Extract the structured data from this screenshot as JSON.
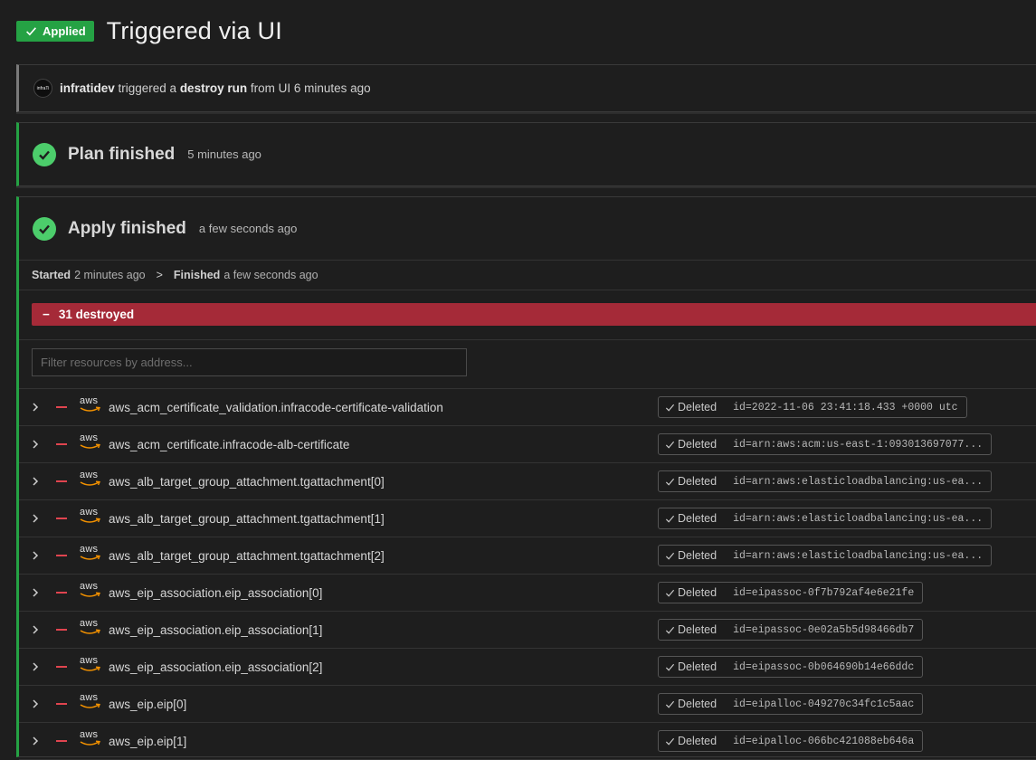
{
  "header": {
    "badge": "Applied",
    "title": "Triggered via UI"
  },
  "trigger": {
    "avatar_text": "infraTi",
    "user": "infratidev",
    "text1": " triggered a ",
    "run_type": "destroy run",
    "text2": " from UI 6 minutes ago"
  },
  "plan": {
    "title": "Plan finished",
    "time": "5 minutes ago"
  },
  "apply": {
    "title": "Apply finished",
    "time": "a few seconds ago",
    "started_label": "Started",
    "started_time": "2 minutes ago",
    "separator": ">",
    "finished_label": "Finished",
    "finished_time": "a few seconds ago",
    "destroyed_summary": "31 destroyed",
    "filter_placeholder": "Filter resources by address..."
  },
  "resources": [
    {
      "address": "aws_acm_certificate_validation.infracode-certificate-validation",
      "status": "Deleted",
      "id": "id=2022-11-06 23:41:18.433 +0000 utc"
    },
    {
      "address": "aws_acm_certificate.infracode-alb-certificate",
      "status": "Deleted",
      "id": "id=arn:aws:acm:us-east-1:093013697077..."
    },
    {
      "address": "aws_alb_target_group_attachment.tgattachment[0]",
      "status": "Deleted",
      "id": "id=arn:aws:elasticloadbalancing:us-ea..."
    },
    {
      "address": "aws_alb_target_group_attachment.tgattachment[1]",
      "status": "Deleted",
      "id": "id=arn:aws:elasticloadbalancing:us-ea..."
    },
    {
      "address": "aws_alb_target_group_attachment.tgattachment[2]",
      "status": "Deleted",
      "id": "id=arn:aws:elasticloadbalancing:us-ea..."
    },
    {
      "address": "aws_eip_association.eip_association[0]",
      "status": "Deleted",
      "id": "id=eipassoc-0f7b792af4e6e21fe"
    },
    {
      "address": "aws_eip_association.eip_association[1]",
      "status": "Deleted",
      "id": "id=eipassoc-0e02a5b5d98466db7"
    },
    {
      "address": "aws_eip_association.eip_association[2]",
      "status": "Deleted",
      "id": "id=eipassoc-0b064690b14e66ddc"
    },
    {
      "address": "aws_eip.eip[0]",
      "status": "Deleted",
      "id": "id=eipalloc-049270c34fc1c5aac"
    },
    {
      "address": "aws_eip.eip[1]",
      "status": "Deleted",
      "id": "id=eipalloc-066bc421088eb646a"
    }
  ],
  "provider_logo_text": "aws",
  "colors": {
    "success": "#25a244",
    "check": "#4ccd6b",
    "destroy": "#a52a38",
    "minus": "#e0444f",
    "aws_smile": "#f29100"
  }
}
